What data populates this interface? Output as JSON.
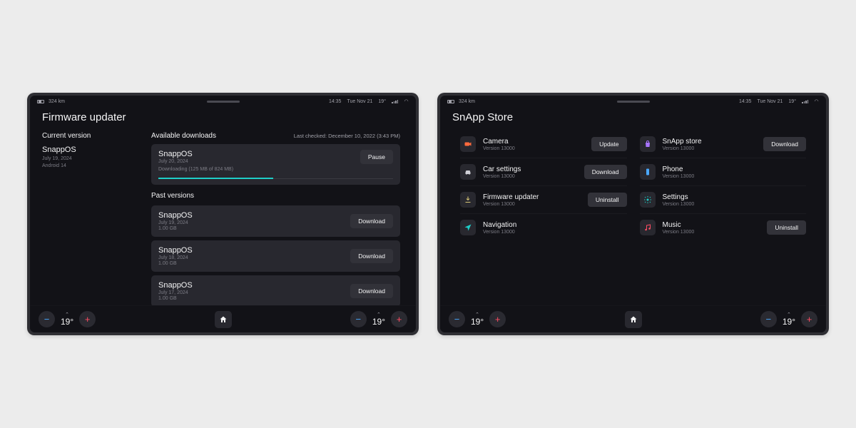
{
  "statusbar": {
    "range": "324 km",
    "time": "14:35",
    "date": "Tue Nov 21",
    "temperature": "19°"
  },
  "firmware": {
    "title": "Firmware updater",
    "current_label": "Current version",
    "current": {
      "name": "SnappOS",
      "date": "July 19, 2024",
      "android": "Android 14"
    },
    "available_label": "Available downloads",
    "last_checked": "Last checked: December 10, 2022 (3:43 PM)",
    "downloading": {
      "name": "SnappOS",
      "date": "July 20, 2024",
      "status": "Downloading (125 MB of 824 MB)",
      "percent": 49,
      "action": "Pause"
    },
    "past_label": "Past versions",
    "past": [
      {
        "name": "SnappOS",
        "date": "July 19, 2024",
        "size": "1.00 GB",
        "action": "Download"
      },
      {
        "name": "SnappOS",
        "date": "July 18, 2024",
        "size": "1.00 GB",
        "action": "Download"
      },
      {
        "name": "SnappOS",
        "date": "July 17, 2024",
        "size": "1.00 GB",
        "action": "Download"
      }
    ]
  },
  "store": {
    "title": "SnApp Store",
    "apps": [
      {
        "name": "Camera",
        "version": "Version 13000",
        "action": "Update",
        "icon": "camera",
        "color": "#ff6a3d"
      },
      {
        "name": "SnApp store",
        "version": "Version 13000",
        "action": "Download",
        "icon": "bag",
        "color": "#a874ff"
      },
      {
        "name": "Car settings",
        "version": "Version 13000",
        "action": "Download",
        "icon": "car",
        "color": "#cfcfd6"
      },
      {
        "name": "Phone",
        "version": "Version 13000",
        "action": null,
        "icon": "phone",
        "color": "#4aa8ff"
      },
      {
        "name": "Firmware updater",
        "version": "Version 13000",
        "action": "Uninstall",
        "icon": "download",
        "color": "#d8c676"
      },
      {
        "name": "Settings",
        "version": "Version 13000",
        "action": null,
        "icon": "gear",
        "color": "#1ecec8"
      },
      {
        "name": "Navigation",
        "version": "Version 13000",
        "action": null,
        "icon": "nav",
        "color": "#1ecec8"
      },
      {
        "name": "Music",
        "version": "Version 13000",
        "action": "Uninstall",
        "icon": "music",
        "color": "#ff4d64"
      }
    ]
  },
  "climate": {
    "left_temp": "19°",
    "right_temp": "19°"
  }
}
